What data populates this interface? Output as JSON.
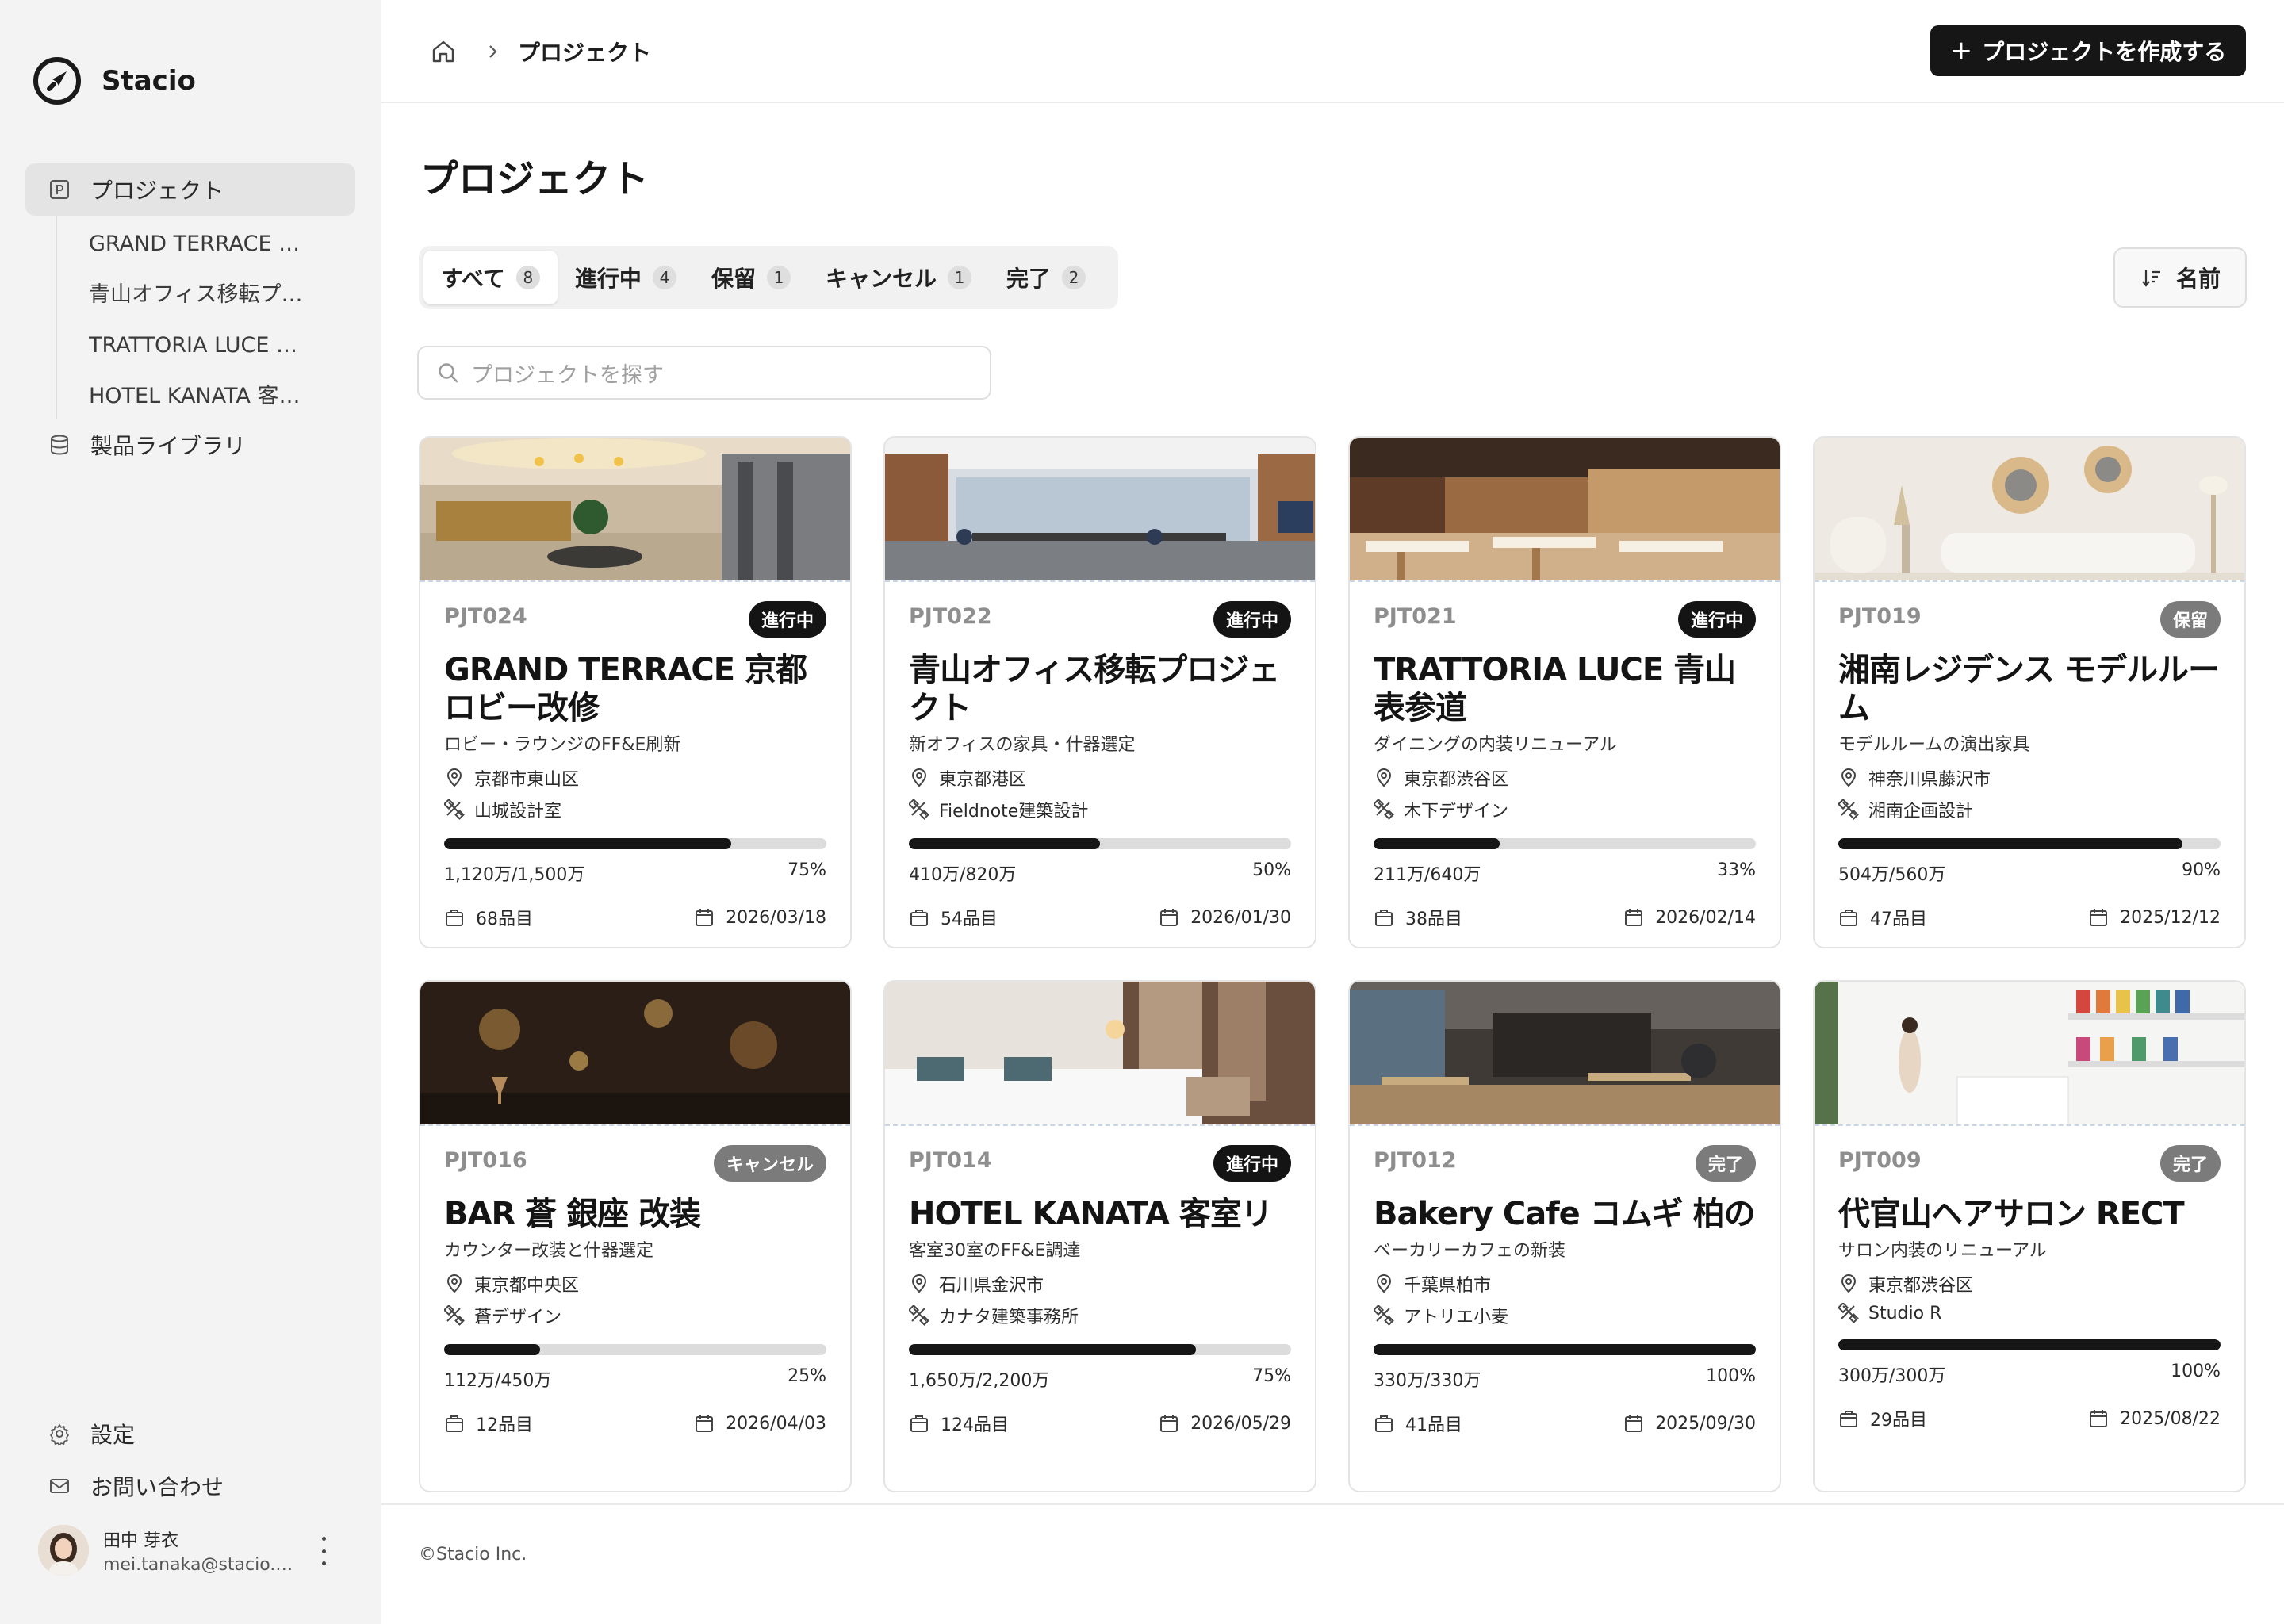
{
  "app": {
    "name": "Stacio"
  },
  "sidebar": {
    "projects_label": "プロジェクト",
    "project_items": [
      "GRAND TERRACE 京…",
      "青山オフィス移転プ…",
      "TRATTORIA LUCE 表…",
      "HOTEL KANATA 客室…"
    ],
    "library_label": "製品ライブラリ",
    "settings_label": "設定",
    "contact_label": "お問い合わせ",
    "user": {
      "name": "田中 芽衣",
      "email": "mei.tanaka@stacio.c…"
    }
  },
  "header": {
    "breadcrumb_current": "プロジェクト",
    "create_button": "プロジェクトを作成する"
  },
  "main": {
    "title": "プロジェクト",
    "tabs": [
      {
        "label": "すべて",
        "count": "8"
      },
      {
        "label": "進行中",
        "count": "4"
      },
      {
        "label": "保留",
        "count": "1"
      },
      {
        "label": "キャンセル",
        "count": "1"
      },
      {
        "label": "完了",
        "count": "2"
      }
    ],
    "sort_label": "名前",
    "search_placeholder": "プロジェクトを探す"
  },
  "cards": [
    {
      "code": "PJT024",
      "status": "進行中",
      "status_style": "dark",
      "title": "GRAND TERRACE 京都 ロビー改修",
      "desc": "ロビー・ラウンジのFF&E刷新",
      "location": "京都市東山区",
      "designer": "山城設計室",
      "amount": "1,120万/1,500万",
      "percent": "75%",
      "progress": 0.75,
      "items": "68品目",
      "date": "2026/03/18",
      "photo": "hotel-lobby"
    },
    {
      "code": "PJT022",
      "status": "進行中",
      "status_style": "dark",
      "title": "青山オフィス移転プロジェクト",
      "desc": "新オフィスの家具・什器選定",
      "location": "東京都港区",
      "designer": "Fieldnote建築設計",
      "amount": "410万/820万",
      "percent": "50%",
      "progress": 0.5,
      "items": "54品目",
      "date": "2026/01/30",
      "photo": "office"
    },
    {
      "code": "PJT021",
      "status": "進行中",
      "status_style": "dark",
      "title": "TRATTORIA LUCE 青山表参道",
      "desc": "ダイニングの内装リニューアル",
      "location": "東京都渋谷区",
      "designer": "木下デザイン",
      "amount": "211万/640万",
      "percent": "33%",
      "progress": 0.33,
      "items": "38品目",
      "date": "2026/02/14",
      "photo": "restaurant"
    },
    {
      "code": "PJT019",
      "status": "保留",
      "status_style": "gray",
      "title": "湘南レジデンス モデルルーム",
      "desc": "モデルルームの演出家具",
      "location": "神奈川県藤沢市",
      "designer": "湘南企画設計",
      "amount": "504万/560万",
      "percent": "90%",
      "progress": 0.9,
      "items": "47品目",
      "date": "2025/12/12",
      "photo": "living"
    },
    {
      "code": "PJT016",
      "status": "キャンセル",
      "status_style": "gray",
      "title": "BAR 蒼 銀座 改装",
      "desc": "カウンター改装と什器選定",
      "location": "東京都中央区",
      "designer": "蒼デザイン",
      "amount": "112万/450万",
      "percent": "25%",
      "progress": 0.25,
      "items": "12品目",
      "date": "2026/04/03",
      "photo": "bar"
    },
    {
      "code": "PJT014",
      "status": "進行中",
      "status_style": "dark",
      "title": "HOTEL KANATA 客室リノベ",
      "desc": "客室30室のFF&E調達",
      "location": "石川県金沢市",
      "designer": "カナタ建築事務所",
      "amount": "1,650万/2,200万",
      "percent": "75%",
      "progress": 0.75,
      "items": "124品目",
      "date": "2026/05/29",
      "photo": "bedroom"
    },
    {
      "code": "PJT012",
      "status": "完了",
      "status_style": "gray",
      "title": "Bakery Cafe コムギ 柏の葉",
      "desc": "ベーカリーカフェの新装",
      "location": "千葉県柏市",
      "designer": "アトリエ小麦",
      "amount": "330万/330万",
      "percent": "100%",
      "progress": 1.0,
      "items": "41品目",
      "date": "2025/09/30",
      "photo": "cafe"
    },
    {
      "code": "PJT009",
      "status": "完了",
      "status_style": "gray",
      "title": "代官山ヘアサロン RECT",
      "desc": "サロン内装のリニューアル",
      "location": "東京都渋谷区",
      "designer": "Studio R",
      "amount": "300万/300万",
      "percent": "100%",
      "progress": 1.0,
      "items": "29品目",
      "date": "2025/08/22",
      "photo": "salon"
    }
  ],
  "footer": {
    "copyright": "©Stacio Inc."
  }
}
